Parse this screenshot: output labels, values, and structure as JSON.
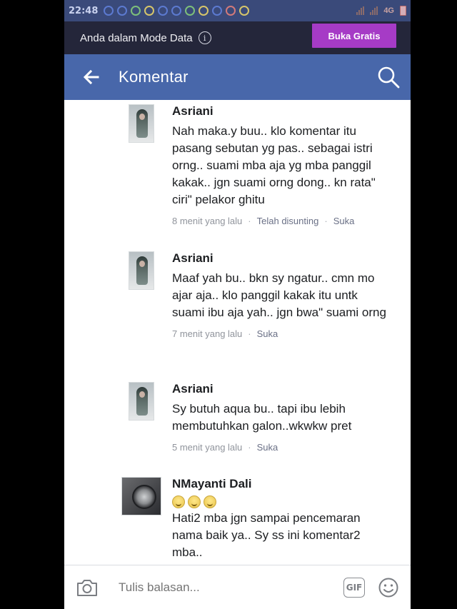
{
  "status_bar": {
    "time": "22:48",
    "network": "4G"
  },
  "data_mode_banner": {
    "message": "Anda dalam Mode Data",
    "info_icon": "i",
    "cta_label": "Buka Gratis"
  },
  "header": {
    "title": "Komentar",
    "back_icon": "arrow-left-icon",
    "search_icon": "search-icon"
  },
  "comments": [
    {
      "author": "Asriani",
      "text": "Nah maka.y buu.. klo komentar itu pasang sebutan yg pas.. sebagai istri orng.. suami mba aja yg mba panggil kakak.. jgn suami orng dong.. kn rata\" ciri\" pelakor ghitu",
      "time": "8 menit yang lalu",
      "edited": "Telah disunting",
      "like": "Suka"
    },
    {
      "author": "Asriani",
      "text": "Maaf yah bu.. bkn sy ngatur.. cmn mo ajar aja.. klo panggil kakak itu untk suami ibu aja yah.. jgn bwa\" suami orng",
      "time": "7 menit yang lalu",
      "like": "Suka"
    },
    {
      "author": "Asriani",
      "text": "Sy butuh aqua bu.. tapi ibu lebih membutuhkan galon..wkwkw pret",
      "time": "5 menit yang lalu",
      "like": "Suka"
    },
    {
      "author": "NMayanti Dali",
      "emoji_count": 3,
      "text": "Hati2 mba jgn sampai pencemaran nama baik ya.. Sy ss ini komentar2 mba.."
    }
  ],
  "composer": {
    "placeholder": "Tulis balasan...",
    "gif_label": "GIF"
  },
  "colors": {
    "nav_blue": "#4867aa",
    "banner_dark": "#24263a",
    "cta_purple": "#a63bc6"
  }
}
